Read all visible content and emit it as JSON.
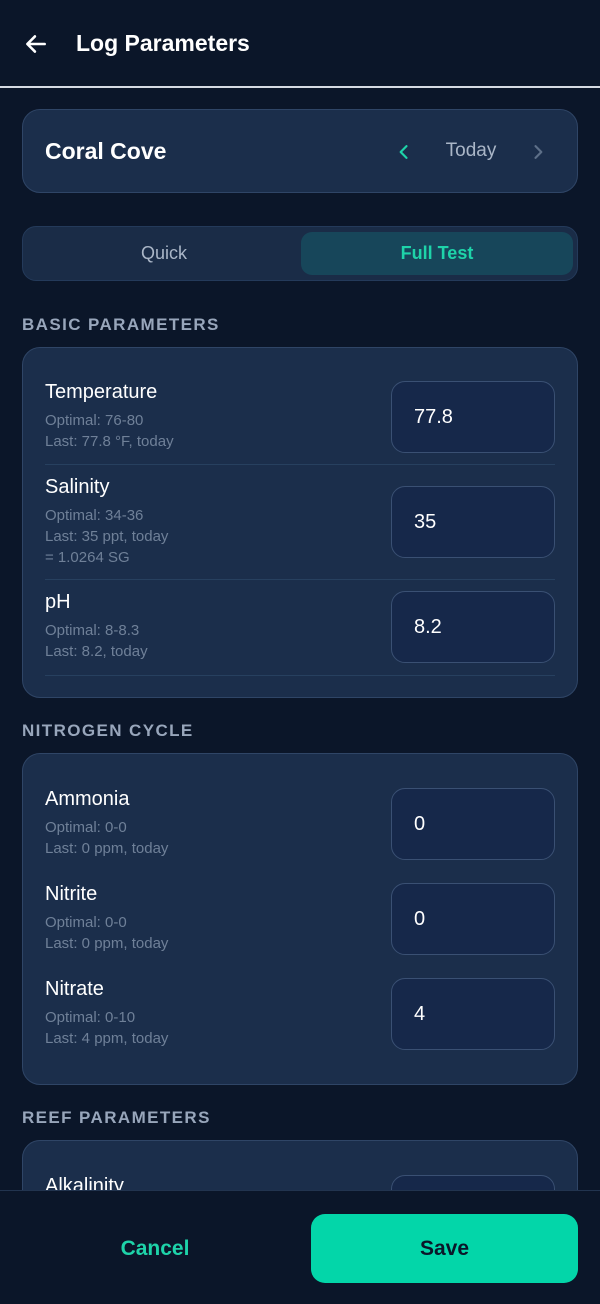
{
  "header": {
    "title": "Log Parameters",
    "back_icon": "arrow-left-icon"
  },
  "tank": {
    "name": "Coral Cove",
    "date_label": "Today",
    "prev_icon": "chevron-left-icon",
    "next_icon": "chevron-right-icon"
  },
  "mode_tabs": {
    "quick": "Quick",
    "full": "Full Test",
    "selected": "Full Test"
  },
  "sections": {
    "basic": {
      "title": "BASIC PARAMETERS",
      "params": [
        {
          "name": "Temperature",
          "optimal": "Optimal: 76-80",
          "last": "Last: 77.8 °F, today",
          "value": "77.8"
        },
        {
          "name": "Salinity",
          "optimal": "Optimal: 34-36",
          "last": "Last: 35 ppt, today",
          "extra": "= 1.0264 SG",
          "value": "35"
        },
        {
          "name": "pH",
          "optimal": "Optimal: 8-8.3",
          "last": "Last: 8.2, today",
          "value": "8.2"
        }
      ]
    },
    "nitrogen": {
      "title": "NITROGEN CYCLE",
      "params": [
        {
          "name": "Ammonia",
          "optimal": "Optimal: 0-0",
          "last": "Last: 0 ppm, today",
          "value": "0"
        },
        {
          "name": "Nitrite",
          "optimal": "Optimal: 0-0",
          "last": "Last: 0 ppm, today",
          "value": "0"
        },
        {
          "name": "Nitrate",
          "optimal": "Optimal: 0-10",
          "last": "Last: 4 ppm, today",
          "value": "4"
        }
      ]
    },
    "reef": {
      "title": "REEF PARAMETERS",
      "params": [
        {
          "name": "Alkalinity"
        }
      ]
    }
  },
  "footer": {
    "cancel": "Cancel",
    "save": "Save"
  },
  "colors": {
    "background": "#0b1629",
    "card": "#1b2e4b",
    "accent": "#03d6a9",
    "accent_text": "#1ed3a9"
  }
}
